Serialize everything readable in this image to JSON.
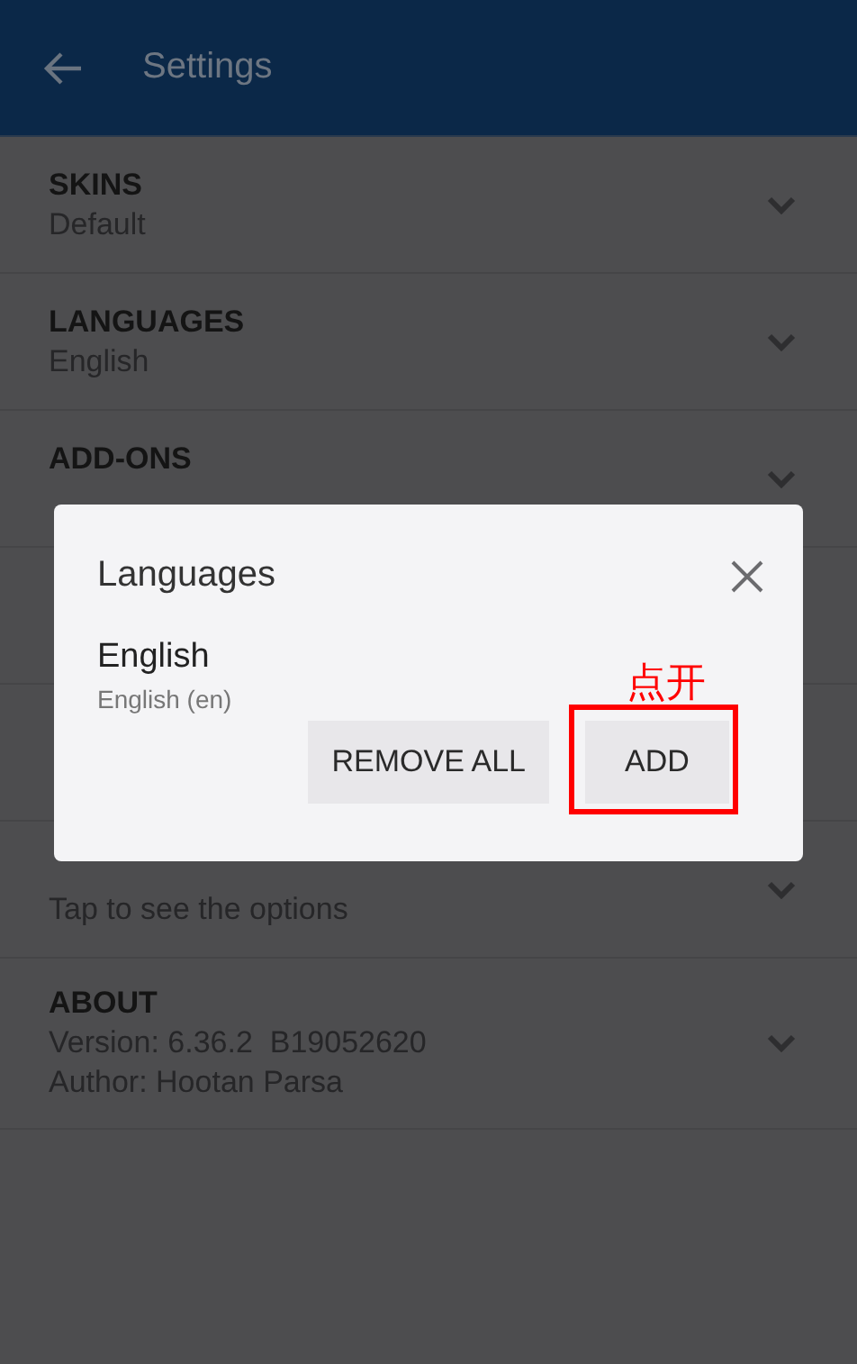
{
  "header": {
    "title": "Settings"
  },
  "settings": [
    {
      "title": "SKINS",
      "lines": [
        "Default"
      ]
    },
    {
      "title": "LANGUAGES",
      "lines": [
        "English"
      ]
    },
    {
      "title": "ADD-ONS"
    },
    {
      "lines": [
        "Tap to see the options"
      ]
    },
    {
      "title": "ABOUT",
      "lines": [
        "Version: 6.36.2  B19052620",
        "Author: Hootan Parsa"
      ]
    }
  ],
  "dialog": {
    "title": "Languages",
    "languages": [
      {
        "name": "English",
        "detail": "English (en)"
      }
    ],
    "annotation": "点开",
    "buttons": [
      {
        "label": "REMOVE ALL",
        "highlighted": false
      },
      {
        "label": "ADD",
        "highlighted": true
      }
    ]
  }
}
